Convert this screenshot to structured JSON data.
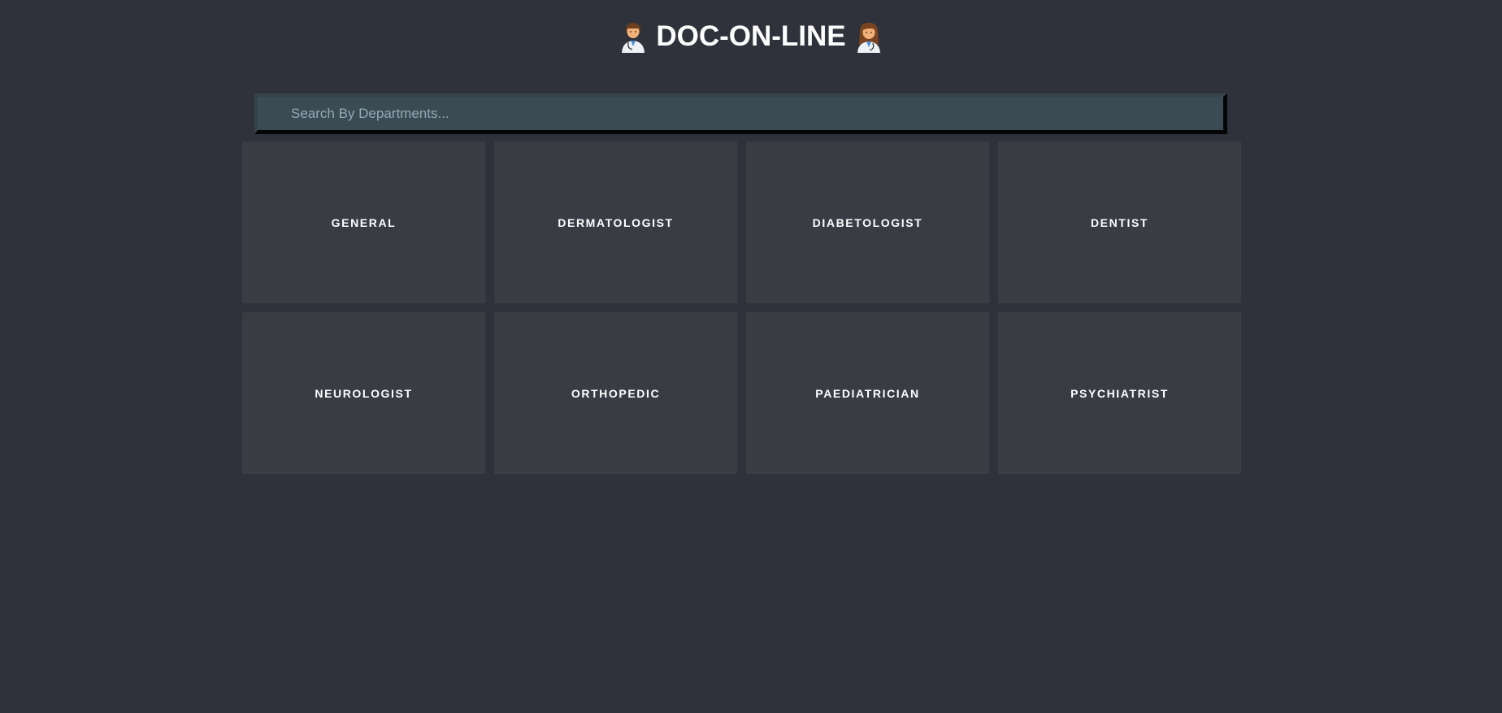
{
  "header": {
    "title": "DOC-ON-LINE",
    "left_icon": "man-health-worker-icon",
    "right_icon": "woman-health-worker-icon"
  },
  "search": {
    "placeholder": "Search By Departments...",
    "value": ""
  },
  "departments": [
    {
      "label": "GENERAL"
    },
    {
      "label": "DERMATOLOGIST"
    },
    {
      "label": "DIABETOLOGIST"
    },
    {
      "label": "DENTIST"
    },
    {
      "label": "NEUROLOGIST"
    },
    {
      "label": "ORTHOPEDIC"
    },
    {
      "label": "PAEDIATRICIAN"
    },
    {
      "label": "PSYCHIATRIST"
    }
  ],
  "colors": {
    "background": "#2f323a",
    "card": "#3a3c44",
    "search_bg": "#3a4b54",
    "text": "#ffffff"
  }
}
